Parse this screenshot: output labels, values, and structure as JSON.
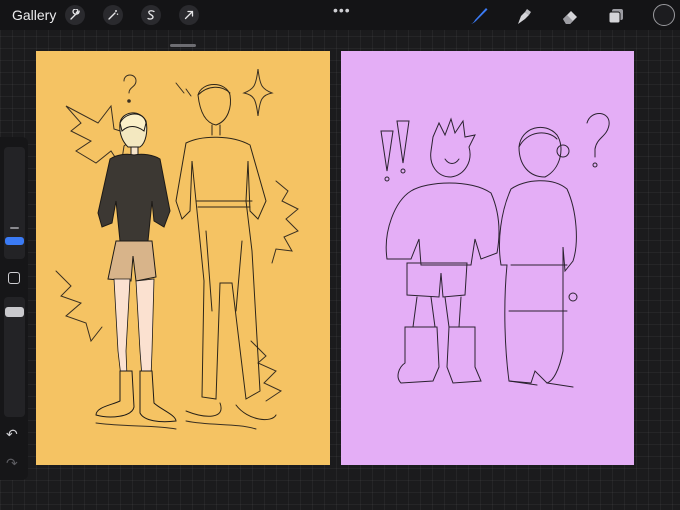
{
  "toolbar": {
    "gallery_label": "Gallery",
    "more_dots": "•••"
  },
  "icons": {
    "actions": "wrench-icon",
    "adjustments": "magic-wand-icon",
    "selection": "selection-s-icon",
    "transform": "arrow-cursor-icon",
    "brush": "brush-icon",
    "smudge": "smudge-icon",
    "eraser": "eraser-icon",
    "layers": "layers-icon",
    "undo": "undo-icon",
    "redo": "redo-icon"
  },
  "colors": {
    "accent": "#3b7bf5",
    "current_color": "#1c1c1f",
    "canvas_left_bg": "#f5c363",
    "canvas_right_bg": "#e4aef6"
  },
  "sidebar": {
    "undo_glyph": "↶",
    "redo_glyph": "↷"
  }
}
